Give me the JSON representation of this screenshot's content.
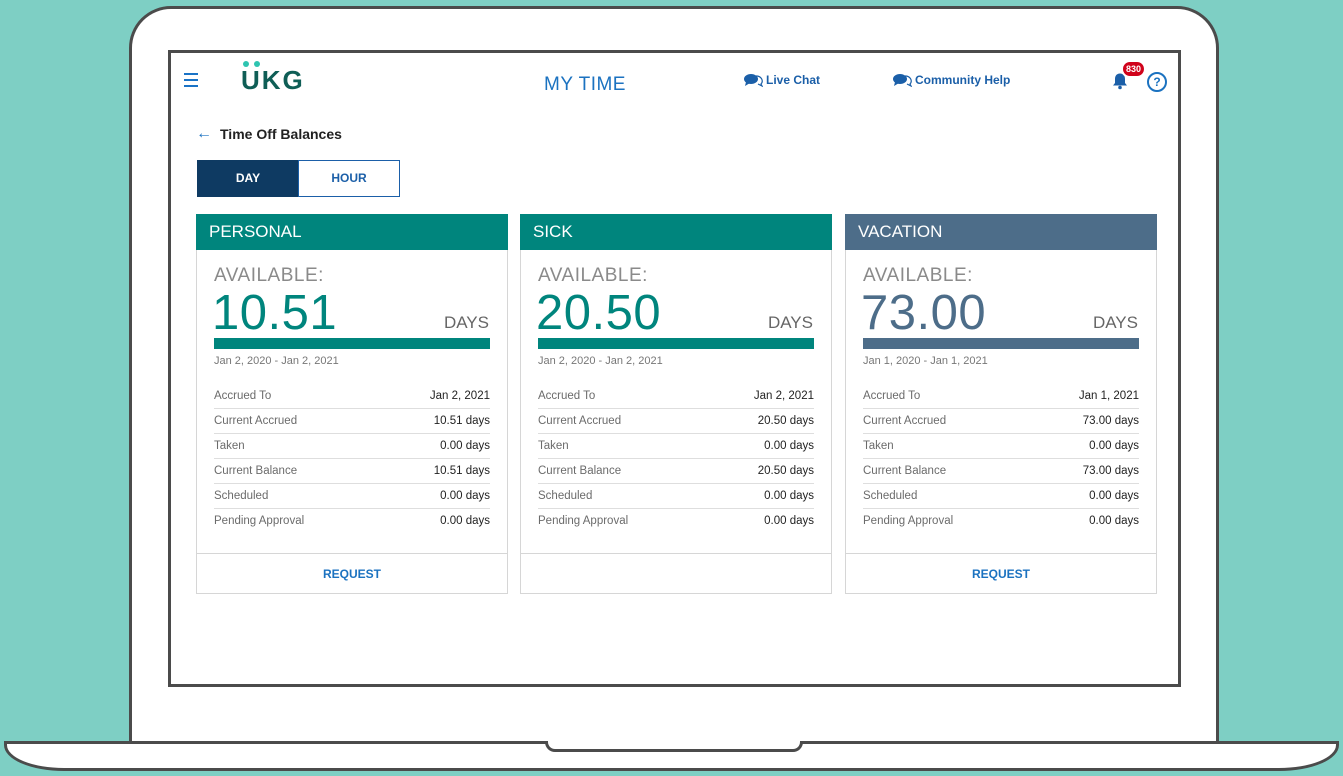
{
  "header": {
    "logo_text": "UKG",
    "app_title": "MY TIME",
    "live_chat": "Live Chat",
    "community_help": "Community Help",
    "notification_count": "830",
    "help_symbol": "?"
  },
  "page": {
    "back_arrow": "←",
    "title": "Time Off Balances"
  },
  "toggle": {
    "day": "DAY",
    "hour": "HOUR",
    "selected": "DAY"
  },
  "colors": {
    "personal": "#00857d",
    "sick": "#00857d",
    "vacation": "#4d6d89",
    "link": "#1b72c0",
    "badge": "#d0021b"
  },
  "cards": [
    {
      "name": "PERSONAL",
      "available_label": "AVAILABLE:",
      "available": "10.51",
      "unit": "DAYS",
      "period": "Jan 2, 2020 - Jan 2, 2021",
      "rows": [
        {
          "label": "Accrued To",
          "value": "Jan 2, 2021"
        },
        {
          "label": "Current Accrued",
          "value": "10.51 days"
        },
        {
          "label": "Taken",
          "value": "0.00 days"
        },
        {
          "label": "Current Balance",
          "value": "10.51 days"
        },
        {
          "label": "Scheduled",
          "value": "0.00 days"
        },
        {
          "label": "Pending Approval",
          "value": "0.00 days"
        }
      ],
      "action": "REQUEST"
    },
    {
      "name": "SICK",
      "available_label": "AVAILABLE:",
      "available": "20.50",
      "unit": "DAYS",
      "period": "Jan 2, 2020 - Jan 2, 2021",
      "rows": [
        {
          "label": "Accrued To",
          "value": "Jan 2, 2021"
        },
        {
          "label": "Current Accrued",
          "value": "20.50 days"
        },
        {
          "label": "Taken",
          "value": "0.00 days"
        },
        {
          "label": "Current Balance",
          "value": "20.50 days"
        },
        {
          "label": "Scheduled",
          "value": "0.00 days"
        },
        {
          "label": "Pending Approval",
          "value": "0.00 days"
        }
      ],
      "action": ""
    },
    {
      "name": "VACATION",
      "available_label": "AVAILABLE:",
      "available": "73.00",
      "unit": "DAYS",
      "period": "Jan 1, 2020 - Jan 1, 2021",
      "rows": [
        {
          "label": "Accrued To",
          "value": "Jan 1, 2021"
        },
        {
          "label": "Current Accrued",
          "value": "73.00 days"
        },
        {
          "label": "Taken",
          "value": "0.00 days"
        },
        {
          "label": "Current Balance",
          "value": "73.00 days"
        },
        {
          "label": "Scheduled",
          "value": "0.00 days"
        },
        {
          "label": "Pending Approval",
          "value": "0.00 days"
        }
      ],
      "action": "REQUEST"
    }
  ]
}
